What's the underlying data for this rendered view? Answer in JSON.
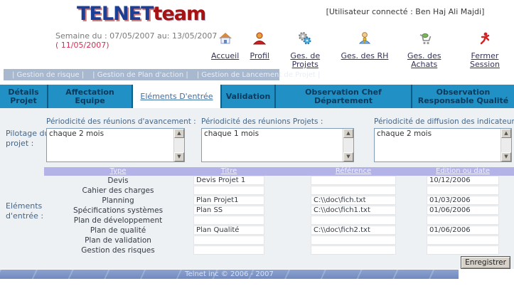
{
  "header": {
    "logo_part1": "TELNET",
    "logo_part2": "team",
    "user_connected": "[Utilisateur connecté : Ben Haj Ali Majdi]",
    "week_line1": "Semaine du : 07/05/2007 au: 13/05/2007",
    "week_line2": "( 11/05/2007)",
    "menu": [
      {
        "label": "Accueil"
      },
      {
        "label": "Profil"
      },
      {
        "label": "Ges. de Projets"
      },
      {
        "label": "Ges. des RH"
      },
      {
        "label": "Ges. des Achats"
      },
      {
        "label": "Fermer Session"
      }
    ]
  },
  "navbar": {
    "items": [
      "| Gestion de risque |",
      "| Gestion de Plan d'action |",
      "| Gestion de Lancement de Projet |"
    ]
  },
  "tabs": [
    {
      "label": "Détails Projet",
      "active": false
    },
    {
      "label": "Affectation Equipe",
      "active": false
    },
    {
      "label": "Eléments D'entrée",
      "active": true
    },
    {
      "label": "Validation",
      "active": false
    },
    {
      "label": "Observation Chef Département",
      "active": false
    },
    {
      "label": "Observation Responsable Qualité",
      "active": false
    }
  ],
  "pilotage": {
    "section_label": "Pilotage du projet :",
    "fields": [
      {
        "label": "Périodicité des réunions d'avancement :",
        "value": "chaque 2 mois"
      },
      {
        "label": "Périodicité des réunions Projets :",
        "value": "chaque 1 mois"
      },
      {
        "label": "Périodicité de diffusion des indicateurs qualité",
        "value": "chaque 2 mois"
      }
    ]
  },
  "elements": {
    "section_label": "Eléments d'entrée :",
    "columns": [
      "Type",
      "Titre",
      "Référence",
      "Edition ou date"
    ],
    "rows": [
      {
        "type": "Devis",
        "titre": "Devis Projet 1",
        "reference": "",
        "edition": "10/12/2006"
      },
      {
        "type": "Cahier des charges",
        "titre": "",
        "reference": "",
        "edition": ""
      },
      {
        "type": "Planning",
        "titre": "Plan Projet1",
        "reference": "C:\\\\doc\\fich.txt",
        "edition": "01/03/2006"
      },
      {
        "type": "Spécifications systèmes",
        "titre": "Plan SS",
        "reference": "C:\\\\doc\\fich1.txt",
        "edition": "01/06/2006"
      },
      {
        "type": "Plan de développement",
        "titre": "",
        "reference": "",
        "edition": ""
      },
      {
        "type": "Plan de qualité",
        "titre": "Plan Qualité",
        "reference": "C:\\\\doc\\fich2.txt",
        "edition": "01/06/2006"
      },
      {
        "type": "Plan de validation",
        "titre": "",
        "reference": "",
        "edition": ""
      },
      {
        "type": "Gestion des risques",
        "titre": "",
        "reference": "",
        "edition": ""
      }
    ]
  },
  "actions": {
    "save_label": "Enregistrer"
  },
  "footer": {
    "copyright": "Telnet inc © 2006 - 2007"
  },
  "colors": {
    "tab_background": "#2191c5",
    "table_header_background": "#b3b3e8",
    "navstrip_background": "#a8b8ce",
    "footer_background": "#7d95c5",
    "accent_red": "#cc3355",
    "label_blue": "#446688"
  }
}
